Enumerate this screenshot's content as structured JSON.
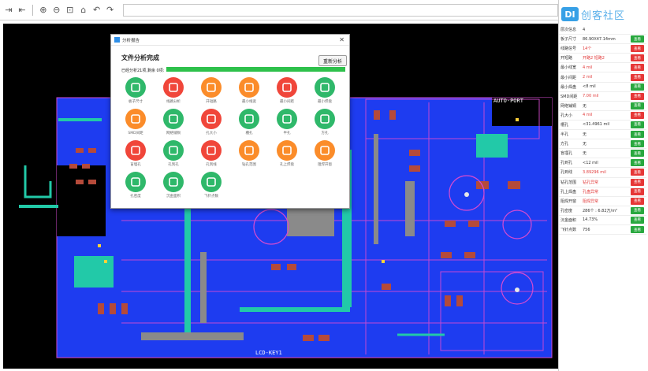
{
  "toolbar": {
    "icons": [
      "expand-icon",
      "collapse-icon",
      "zoom-in-icon",
      "zoom-out-icon",
      "zoom-fit-icon",
      "home-icon",
      "undo-icon",
      "redo-icon"
    ]
  },
  "logo": {
    "mark": "DI",
    "text": "创客社区"
  },
  "dialog": {
    "title": "分析报告",
    "heading": "文件分析完成",
    "reanalyze_label": "重新分析",
    "progress_label": "已经分析21项,剩余 0项:",
    "progress": 1.0,
    "items": [
      {
        "label": "板子尺寸",
        "color": "#2fb86a"
      },
      {
        "label": "线路分析",
        "color": "#f0463a"
      },
      {
        "label": "开短路",
        "color": "#fb8c2a"
      },
      {
        "label": "最小线宽",
        "color": "#fb8c2a"
      },
      {
        "label": "最小间距",
        "color": "#f0463a"
      },
      {
        "label": "最小焊盘",
        "color": "#2fb86a"
      },
      {
        "label": "SMD间距",
        "color": "#fb8c2a"
      },
      {
        "label": "网络铺铜",
        "color": "#2fb86a"
      },
      {
        "label": "孔大小",
        "color": "#f0463a"
      },
      {
        "label": "槽孔",
        "color": "#2fb86a"
      },
      {
        "label": "半孔",
        "color": "#2fb86a"
      },
      {
        "label": "方孔",
        "color": "#2fb86a"
      },
      {
        "label": "盲埋孔",
        "color": "#f0463a"
      },
      {
        "label": "孔到孔",
        "color": "#2fb86a"
      },
      {
        "label": "孔到线",
        "color": "#f0463a"
      },
      {
        "label": "钻孔范围",
        "color": "#fb8c2a"
      },
      {
        "label": "孔上焊盘",
        "color": "#fb8c2a"
      },
      {
        "label": "阻焊开窗",
        "color": "#fb8c2a"
      },
      {
        "label": "孔密度",
        "color": "#2fb86a"
      },
      {
        "label": "沉金面积",
        "color": "#2fb86a"
      },
      {
        "label": "飞针点数",
        "color": "#2fb86a"
      }
    ]
  },
  "sidebar": {
    "rows": [
      {
        "name": "层次信息",
        "value": "4",
        "btn": ""
      },
      {
        "name": "板子尺寸",
        "value": "86.90X47.14mm",
        "btn": "查看"
      },
      {
        "name": "线路信号",
        "value": "14个",
        "btn": "查看",
        "warn": true
      },
      {
        "name": "开短路",
        "value": "开路2 短路2",
        "btn": "查看",
        "warn": true
      },
      {
        "name": "最小线宽",
        "value": "4 mil",
        "btn": "查看",
        "warn": true
      },
      {
        "name": "最小间距",
        "value": "2 mil",
        "btn": "查看",
        "warn": true
      },
      {
        "name": "最小焊盘",
        "value": "<8 mil",
        "btn": "查看"
      },
      {
        "name": "SMD间距",
        "value": "7.00 mil",
        "btn": "查看",
        "warn": true
      },
      {
        "name": "网络铺铜",
        "value": "无",
        "btn": "查看"
      },
      {
        "name": "孔大小",
        "value": "4 mil",
        "btn": "查看",
        "warn": true
      },
      {
        "name": "槽孔",
        "value": "<31.4961 mil",
        "btn": "查看"
      },
      {
        "name": "半孔",
        "value": "无",
        "btn": "查看"
      },
      {
        "name": "方孔",
        "value": "无",
        "btn": "查看"
      },
      {
        "name": "盲埋孔",
        "value": "无",
        "btn": "查看"
      },
      {
        "name": "孔到孔",
        "value": "<12 mil",
        "btn": "查看"
      },
      {
        "name": "孔到线",
        "value": "3.89296 mil",
        "btn": "查看",
        "warn": true
      },
      {
        "name": "钻孔范围",
        "value": "钻孔异常",
        "btn": "查看",
        "warn": true
      },
      {
        "name": "孔上焊盘",
        "value": "孔盘异常",
        "btn": "查看",
        "warn": true
      },
      {
        "name": "阻焊开窗",
        "value": "阻焊异常",
        "btn": "查看",
        "warn": true
      },
      {
        "name": "孔密度",
        "value": "286个 : 6.82万/m²",
        "btn": "查看"
      },
      {
        "name": "沉金面积",
        "value": "14.73%",
        "btn": "查看"
      },
      {
        "name": "飞针点数",
        "value": "756",
        "btn": "查看"
      }
    ],
    "btn_colors": {
      "ok": "#29a83f",
      "bad": "#e63737",
      "warn": "#f29b1a"
    }
  }
}
